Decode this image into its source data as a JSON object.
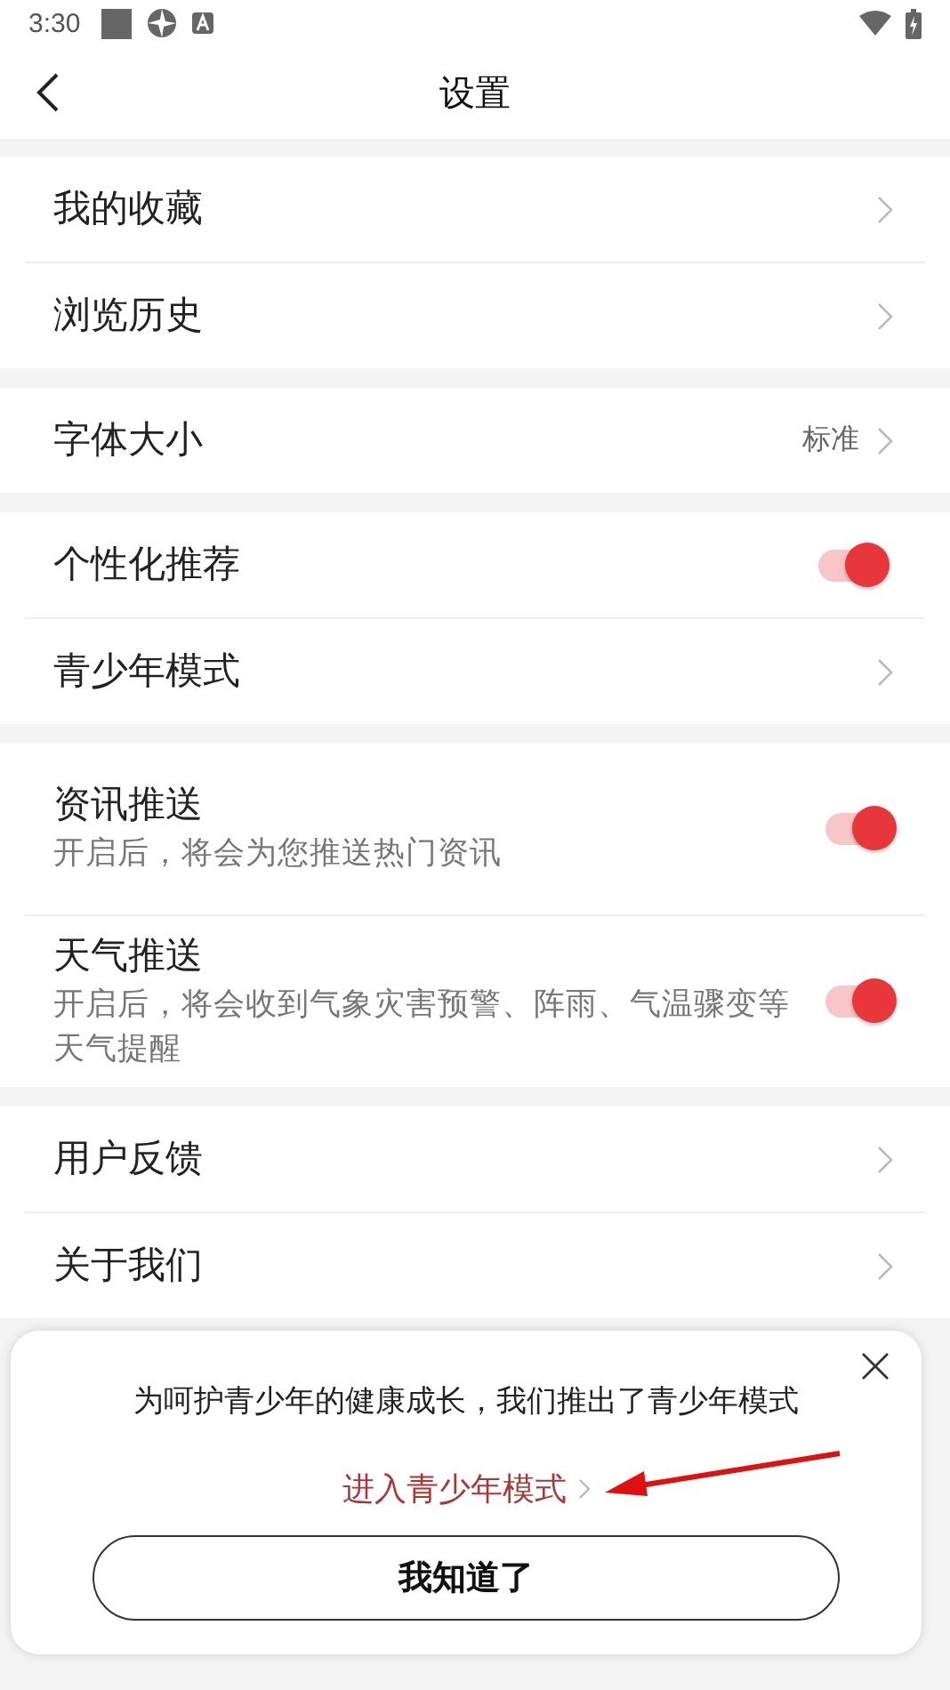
{
  "status_bar": {
    "time": "3:30"
  },
  "header": {
    "title": "设置"
  },
  "groups": [
    {
      "items": [
        {
          "kind": "link",
          "label": "我的收藏"
        },
        {
          "kind": "link",
          "label": "浏览历史"
        }
      ]
    },
    {
      "items": [
        {
          "kind": "link",
          "label": "字体大小",
          "value": "标准"
        }
      ]
    },
    {
      "items": [
        {
          "kind": "toggle",
          "label": "个性化推荐",
          "on": true
        },
        {
          "kind": "link",
          "label": "青少年模式"
        }
      ]
    },
    {
      "items": [
        {
          "kind": "toggle",
          "label": "资讯推送",
          "subtitle": "开启后，将会为您推送热门资讯",
          "on": true
        },
        {
          "kind": "toggle",
          "label": "天气推送",
          "subtitle": "开启后，将会收到气象灾害预警、阵雨、气温骤变等天气提醒",
          "on": true
        }
      ]
    },
    {
      "items": [
        {
          "kind": "link",
          "label": "用户反馈"
        },
        {
          "kind": "link",
          "label": "关于我们"
        }
      ]
    }
  ],
  "popup": {
    "message": "为呵护青少年的健康成长，我们推出了青少年模式",
    "link": "进入青少年模式",
    "button": "我知道了"
  }
}
